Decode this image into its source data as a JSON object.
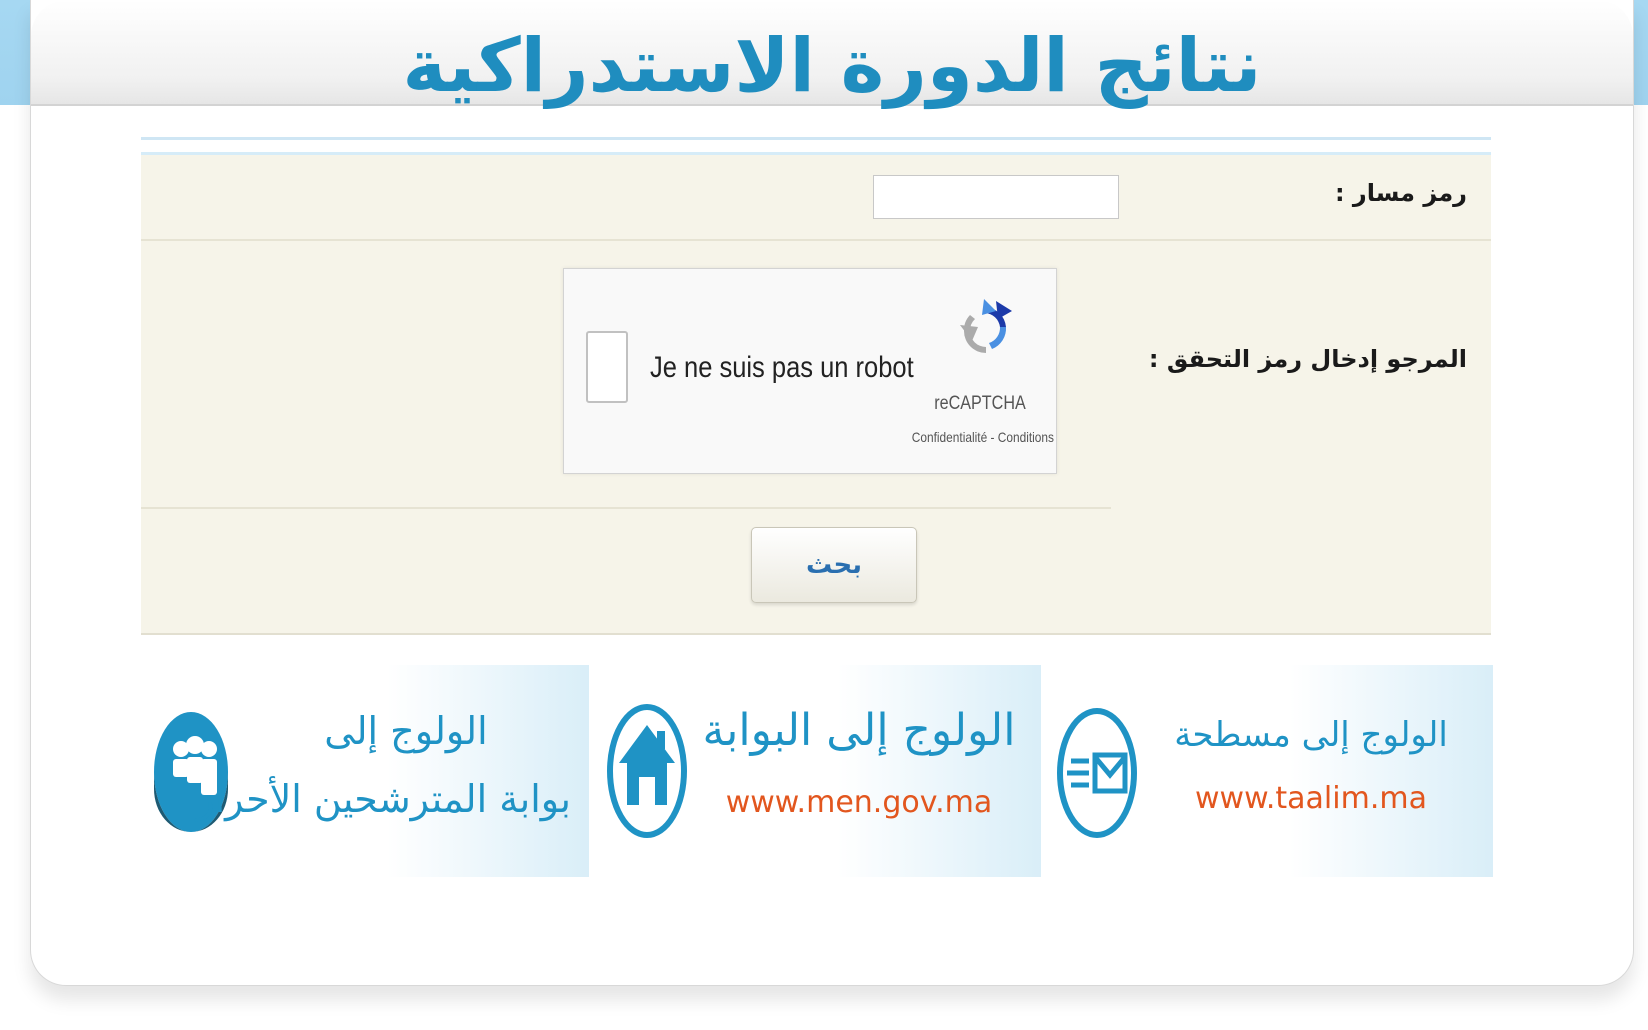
{
  "header": {
    "title": "نتائج الدورة الاستدراكية"
  },
  "form": {
    "massar_label": "رمز مسار :",
    "massar_value": "",
    "captcha_label": "المرجو إدخال رمز التحقق :",
    "captcha": {
      "checkbox_label": "Je ne suis pas un robot",
      "brand": "reCAPTCHA",
      "links": "Confidentialité - Conditions"
    },
    "search_button": "بحث"
  },
  "banners": [
    {
      "line1": "الولوج إلى مسطحة",
      "line2": "www.taalim.ma",
      "icon": "mail-icon"
    },
    {
      "line1": "الولوج إلى البوابة",
      "line2": "www.men.gov.ma",
      "icon": "home-icon"
    },
    {
      "line1": "الولوج إلى",
      "line2": "بوابة المترشحين الأحرار",
      "icon": "myspace-icon"
    }
  ],
  "colors": {
    "title": "#1f8dbf",
    "panel": "#f6f4e9",
    "banner_blue": "#1f93c5",
    "banner_orange": "#e2561e",
    "sky": "#a6d8f2"
  }
}
